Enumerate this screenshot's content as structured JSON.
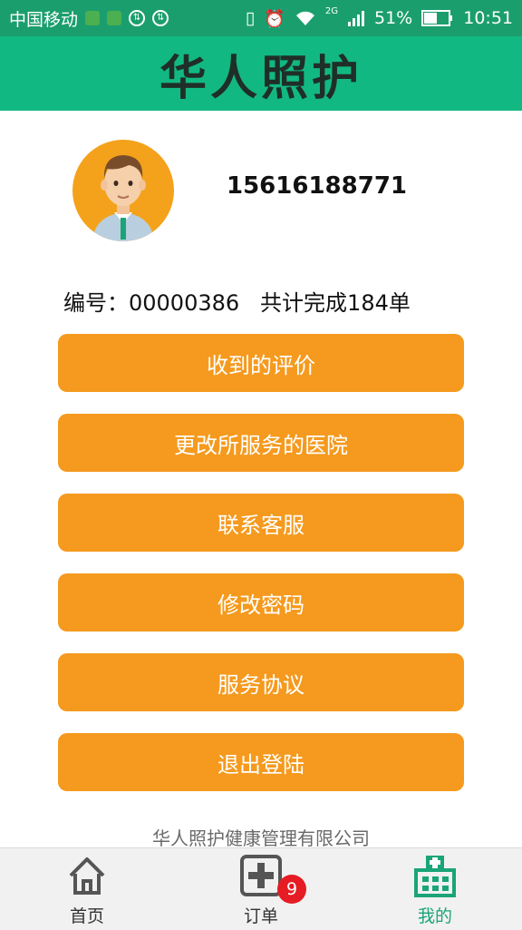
{
  "status_bar": {
    "carrier": "中国移动",
    "network": "2G",
    "battery": "51%",
    "time": "10:51"
  },
  "header": {
    "title": "华人照护"
  },
  "profile": {
    "phone": "15616188771",
    "id_label": "编号：",
    "id_value": "00000386",
    "completed_text": "共计完成184单"
  },
  "menu": [
    {
      "label": "收到的评价"
    },
    {
      "label": "更改所服务的医院"
    },
    {
      "label": "联系客服"
    },
    {
      "label": "修改密码"
    },
    {
      "label": "服务协议"
    },
    {
      "label": "退出登陆"
    }
  ],
  "footer": {
    "company": "华人照护健康管理有限公司"
  },
  "tabbar": {
    "items": [
      {
        "label": "首页",
        "icon": "home-icon"
      },
      {
        "label": "订单",
        "icon": "add-order-icon",
        "badge": "9"
      },
      {
        "label": "我的",
        "icon": "hospital-icon"
      }
    ],
    "active_color": "#1aa478"
  },
  "colors": {
    "header": "#12b882",
    "button": "#f59a1e",
    "badge": "#e51c23"
  }
}
